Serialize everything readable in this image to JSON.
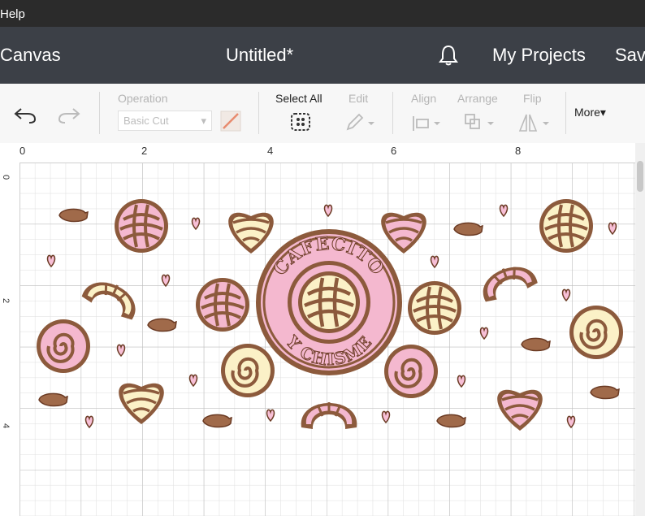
{
  "menu": {
    "help": "Help"
  },
  "header": {
    "canvas": "Canvas",
    "title": "Untitled*",
    "my_projects": "My Projects",
    "save": "Sav"
  },
  "toolbar": {
    "operation": "Operation",
    "operation_value": "Basic Cut",
    "select_all": "Select All",
    "edit": "Edit",
    "align": "Align",
    "arrange": "Arrange",
    "flip": "Flip",
    "more": "More▾"
  },
  "ruler": {
    "h": [
      "0",
      "2",
      "4",
      "6",
      "8"
    ],
    "v": [
      "0",
      "2",
      "4"
    ]
  },
  "design": {
    "badge_line1": "CAFECITO",
    "badge_line2": "Y CHISME",
    "colors": {
      "brown": "#8c5a3c",
      "pink": "#f4b8cf",
      "cream": "#fbf1c7",
      "outline": "#6b3b24",
      "heart": "#f7bfd6"
    }
  }
}
